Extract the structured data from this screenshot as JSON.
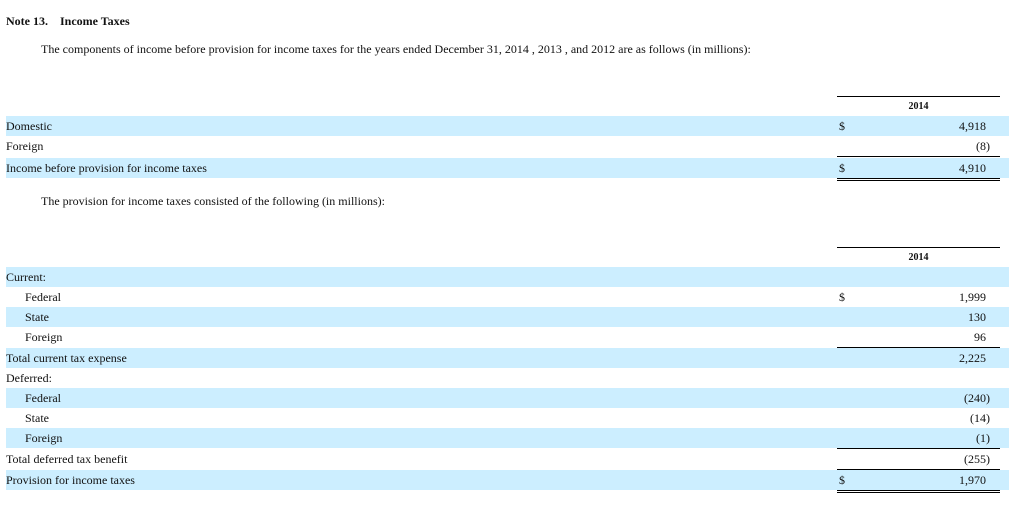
{
  "note": {
    "number": "Note 13.",
    "title": "Income Taxes"
  },
  "table1": {
    "intro": "The components of income before provision for income taxes for the years ended December 31, 2014 , 2013 , and 2012 are as follows (in millions):",
    "year": "2014",
    "rows": [
      {
        "label": "Domestic",
        "dollar": "$",
        "value": "4,918"
      },
      {
        "label": "Foreign",
        "dollar": "",
        "value": "(8)"
      },
      {
        "label": "Income before provision for income taxes",
        "dollar": "$",
        "value": "4,910"
      }
    ]
  },
  "table2": {
    "intro": "The provision for income taxes consisted of the following (in millions):",
    "year": "2014",
    "rows": [
      {
        "label": "Current:",
        "dollar": "",
        "value": ""
      },
      {
        "label": "Federal",
        "dollar": "$",
        "value": "1,999"
      },
      {
        "label": "State",
        "dollar": "",
        "value": "130"
      },
      {
        "label": "Foreign",
        "dollar": "",
        "value": "96"
      },
      {
        "label": "Total current tax expense",
        "dollar": "",
        "value": "2,225"
      },
      {
        "label": "Deferred:",
        "dollar": "",
        "value": ""
      },
      {
        "label": "Federal",
        "dollar": "",
        "value": "(240)"
      },
      {
        "label": "State",
        "dollar": "",
        "value": "(14)"
      },
      {
        "label": "Foreign",
        "dollar": "",
        "value": "(1)"
      },
      {
        "label": "Total deferred tax benefit",
        "dollar": "",
        "value": "(255)"
      },
      {
        "label": "Provision for income taxes",
        "dollar": "$",
        "value": "1,970"
      }
    ]
  },
  "colors": {
    "row_shade": "#cceeff",
    "text": "#111111"
  }
}
